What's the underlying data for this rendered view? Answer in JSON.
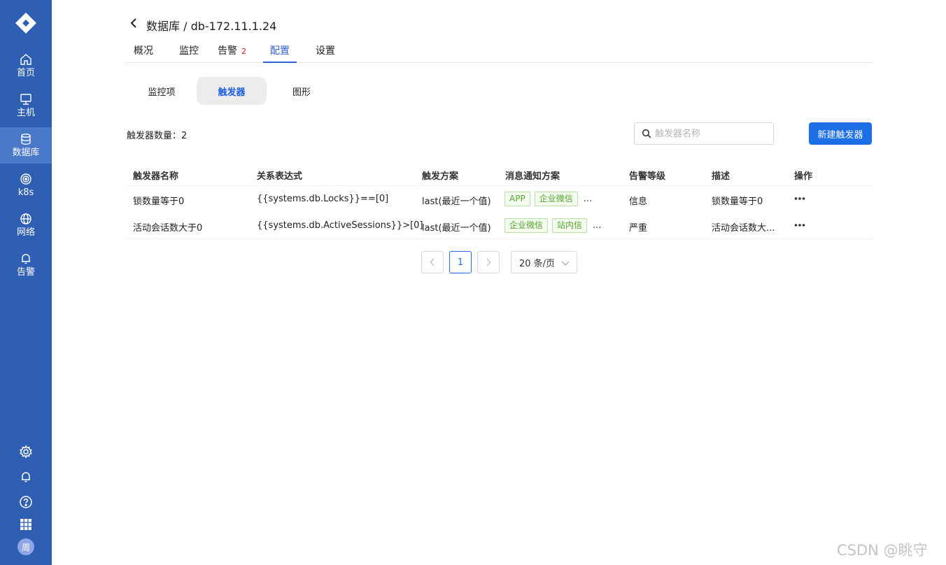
{
  "sidebar": {
    "items": [
      {
        "label": "首页",
        "icon": "home-icon"
      },
      {
        "label": "主机",
        "icon": "monitor-icon"
      },
      {
        "label": "数据库",
        "icon": "database-icon",
        "active": true
      },
      {
        "label": "k8s",
        "icon": "k8s-icon"
      },
      {
        "label": "网络",
        "icon": "globe-icon"
      },
      {
        "label": "告警",
        "icon": "bell-icon"
      }
    ],
    "bottom_icons": [
      "gear-icon",
      "bell-icon",
      "help-icon",
      "apps-grid-icon"
    ],
    "avatar_text": "周"
  },
  "header": {
    "title": "数据库 / db-172.11.1.24",
    "tabs": [
      {
        "label": "概况"
      },
      {
        "label": "监控"
      },
      {
        "label": "告警",
        "badge": "2"
      },
      {
        "label": "配置",
        "active": true
      },
      {
        "label": "设置"
      }
    ]
  },
  "subtabs": [
    {
      "label": "监控项"
    },
    {
      "label": "触发器",
      "active": true
    },
    {
      "label": "图形"
    }
  ],
  "toolbar": {
    "count_label": "触发器数量：2",
    "search_placeholder": "触发器名称",
    "new_button": "新建触发器"
  },
  "table": {
    "columns": [
      "触发器名称",
      "关系表达式",
      "触发方案",
      "消息通知方案",
      "告警等级",
      "描述",
      "操作"
    ],
    "rows": [
      {
        "name": "锁数量等于0",
        "expression": "{{systems.db.Locks}}==[0]",
        "scheme": "last(最近一个值)",
        "notify_tags": [
          "APP",
          "企业微信"
        ],
        "notify_more": "...",
        "level": "信息",
        "description": "锁数量等于0"
      },
      {
        "name": "活动会话数大于0",
        "expression": "{{systems.db.ActiveSessions}}>[0]",
        "scheme": "last(最近一个值)",
        "notify_tags": [
          "企业微信",
          "站内信"
        ],
        "notify_more": "...",
        "level": "严重",
        "description": "活动会话数大..."
      }
    ]
  },
  "pagination": {
    "current_page": "1",
    "page_size": "20 条/页"
  },
  "watermark": "CSDN @眺守",
  "colors": {
    "sidebar_bg": "#2f5fb3",
    "sidebar_active": "#4a78c8",
    "primary": "#1d6fe6",
    "tag_green": "#52a32c",
    "badge_red": "#e02020"
  }
}
